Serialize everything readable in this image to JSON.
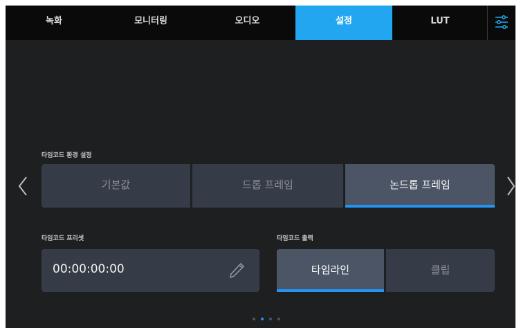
{
  "tabs": [
    {
      "label": "녹화"
    },
    {
      "label": "모니터링"
    },
    {
      "label": "오디오"
    },
    {
      "label": "설정"
    },
    {
      "label": "LUT"
    }
  ],
  "active_tab_index": 3,
  "timecode_mode": {
    "label": "타임코드 환경 설정",
    "options": [
      "기본값",
      "드롭 프레임",
      "논드롭 프레임"
    ],
    "selected": "논드롭 프레임"
  },
  "timecode_preset": {
    "label": "타임코드 프리셋",
    "value": "00:00:00:00"
  },
  "timecode_output": {
    "label": "타임코드 출력",
    "options": [
      "타임라인",
      "클립"
    ],
    "selected": "타임라인"
  },
  "pagination": {
    "page_count": 4,
    "current_page": 2
  },
  "colors": {
    "accent": "#22a6f0",
    "selection_bar": "#2196f3",
    "background": "#1e1f21",
    "control": "#363c47",
    "control_selected": "#4b5566"
  },
  "icons": [
    "menu-sliders-icon",
    "chevron-left-icon",
    "chevron-right-icon",
    "pencil-icon"
  ]
}
